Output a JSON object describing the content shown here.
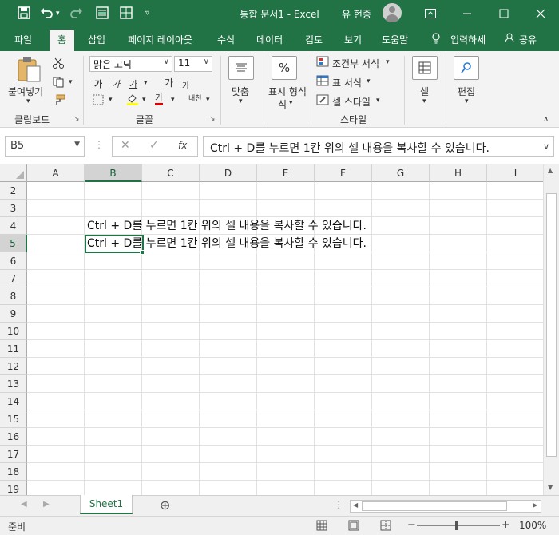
{
  "titlebar": {
    "title": "통합 문서1 - Excel",
    "user": "유 현종",
    "icons": [
      "save-icon",
      "undo-icon",
      "redo-icon",
      "form-icon",
      "table-icon",
      "customize-icon"
    ]
  },
  "tabs": [
    "파일",
    "홈",
    "삽입",
    "페이지 레이아웃",
    "수식",
    "데이터",
    "검토",
    "보기",
    "도움말",
    "입력하세",
    "공유"
  ],
  "ribbon": {
    "clipboard": {
      "paste": "붙여넣기",
      "label": "클립보드"
    },
    "font": {
      "name": "맑은 고딕",
      "size": "11",
      "label": "글꼴",
      "bold": "가",
      "italic": "가",
      "underline": "가",
      "grow": "가",
      "shrink": "가",
      "color": "가",
      "phonetic": "내천"
    },
    "align": {
      "label": "맞춤"
    },
    "number": {
      "label": "표시 형식",
      "label2": "식",
      "glyph": "%"
    },
    "styles": {
      "cond": "조건부 서식",
      "table": "표 서식",
      "cell": "셀 스타일",
      "label": "스타일"
    },
    "cells": {
      "label": "셀"
    },
    "edit": {
      "label": "편집"
    }
  },
  "formula_bar": {
    "namebox": "B5",
    "cancel": "✕",
    "confirm": "✓",
    "fx": "fx",
    "content": "Ctrl + D를 누르면 1칸 위의 셀 내용을 복사할 수 있습니다."
  },
  "grid": {
    "columns": [
      "A",
      "B",
      "C",
      "D",
      "E",
      "F",
      "G",
      "H",
      "I"
    ],
    "rows": [
      "2",
      "3",
      "4",
      "5",
      "6",
      "7",
      "8",
      "9",
      "10",
      "11",
      "12",
      "13",
      "14",
      "15",
      "16",
      "17",
      "18",
      "19"
    ],
    "selected_col": "B",
    "selected_row": "5",
    "cells": {
      "B4": "Ctrl + D를 누르면 1칸 위의 셀 내용을 복사할 수 있습니다.",
      "B5": "Ctrl + D를 누르면 1칸 위의 셀 내용을 복사할 수 있습니다."
    }
  },
  "sheets": {
    "tab": "Sheet1",
    "add": "⊕"
  },
  "status": {
    "mode": "준비",
    "zoom": "100%"
  },
  "colors": {
    "accent": "#217346",
    "ribbon_bg": "#f3f3f3"
  }
}
